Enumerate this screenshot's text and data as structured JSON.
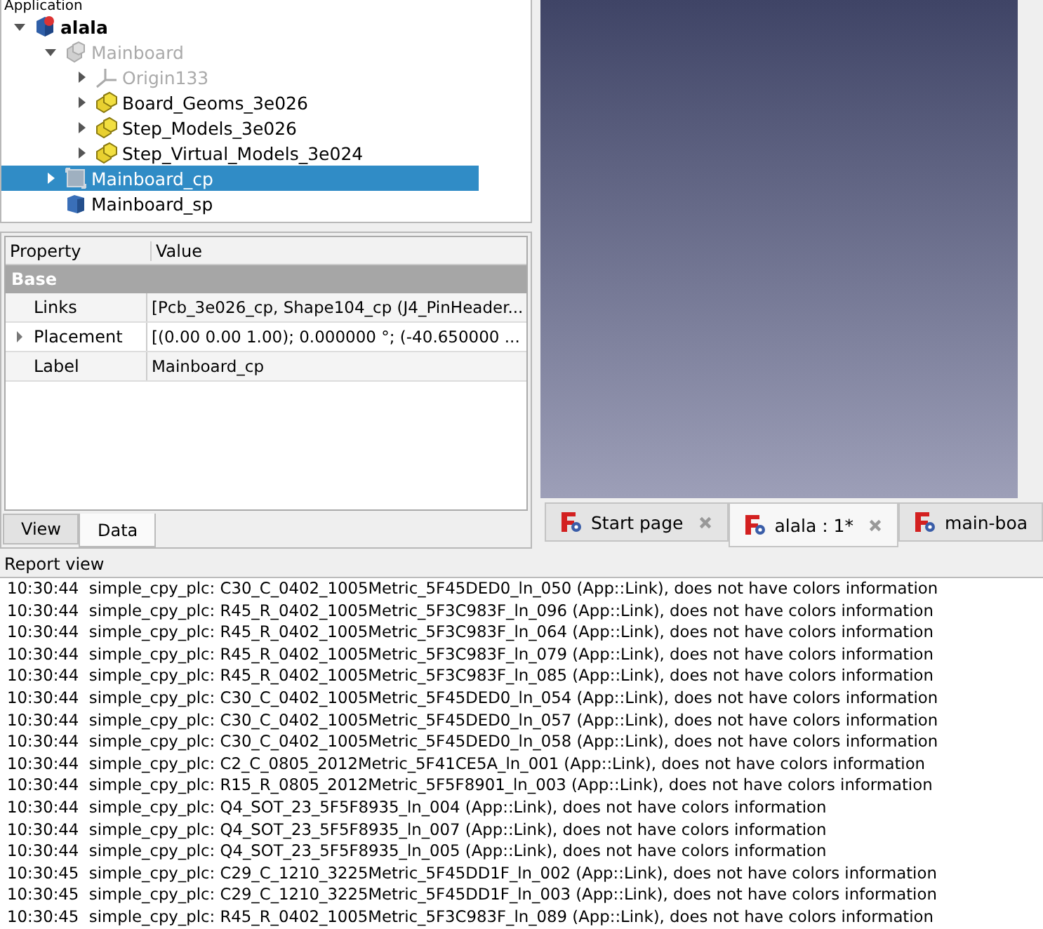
{
  "tree": {
    "title": "Application",
    "items": [
      {
        "label": "alala",
        "kind": "document",
        "bold": true,
        "dimmed": false,
        "selected": false,
        "expandable": true,
        "expanded": true,
        "children": [
          {
            "label": "Mainboard",
            "kind": "part",
            "bold": false,
            "dimmed": true,
            "selected": false,
            "expandable": true,
            "expanded": true,
            "children": [
              {
                "label": "Origin133",
                "kind": "origin",
                "bold": false,
                "dimmed": true,
                "selected": false,
                "expandable": true,
                "expanded": false
              },
              {
                "label": "Board_Geoms_3e026",
                "kind": "group",
                "bold": false,
                "dimmed": false,
                "selected": false,
                "expandable": true,
                "expanded": false
              },
              {
                "label": "Step_Models_3e026",
                "kind": "group",
                "bold": false,
                "dimmed": false,
                "selected": false,
                "expandable": true,
                "expanded": false
              },
              {
                "label": "Step_Virtual_Models_3e024",
                "kind": "group",
                "bold": false,
                "dimmed": false,
                "selected": false,
                "expandable": true,
                "expanded": false
              }
            ]
          },
          {
            "label": "Mainboard_cp",
            "kind": "link",
            "bold": false,
            "dimmed": false,
            "selected": true,
            "expandable": true,
            "expanded": false
          },
          {
            "label": "Mainboard_sp",
            "kind": "box",
            "bold": false,
            "dimmed": false,
            "selected": false,
            "expandable": false
          }
        ]
      }
    ]
  },
  "properties": {
    "columns": [
      "Property",
      "Value"
    ],
    "group": "Base",
    "rows": [
      {
        "name": "Links",
        "value": "[Pcb_3e026_cp, Shape104_cp (J4_PinHeader...",
        "expandable": false
      },
      {
        "name": "Placement",
        "value": "[(0.00 0.00 1.00); 0.000000 °; (-40.650000 ...",
        "expandable": true
      },
      {
        "name": "Label",
        "value": "Mainboard_cp",
        "expandable": false
      }
    ],
    "tabs": [
      {
        "label": "View",
        "selected": false
      },
      {
        "label": "Data",
        "selected": true
      }
    ]
  },
  "document_tabs": [
    {
      "label": "Start page",
      "selected": false,
      "closable": true
    },
    {
      "label": "alala : 1*",
      "selected": true,
      "closable": true
    },
    {
      "label": "main-boa",
      "selected": false,
      "closable": false
    }
  ],
  "report_view": {
    "title": "Report view",
    "lines": [
      {
        "time": "10:30:44",
        "message": "simple_cpy_plc: C30_C_0402_1005Metric_5F45DED0_ln_050 (App::Link), does not have colors information"
      },
      {
        "time": "10:30:44",
        "message": "simple_cpy_plc: R45_R_0402_1005Metric_5F3C983F_ln_096 (App::Link), does not have colors information"
      },
      {
        "time": "10:30:44",
        "message": "simple_cpy_plc: R45_R_0402_1005Metric_5F3C983F_ln_064 (App::Link), does not have colors information"
      },
      {
        "time": "10:30:44",
        "message": "simple_cpy_plc: R45_R_0402_1005Metric_5F3C983F_ln_079 (App::Link), does not have colors information"
      },
      {
        "time": "10:30:44",
        "message": "simple_cpy_plc: R45_R_0402_1005Metric_5F3C983F_ln_085 (App::Link), does not have colors information"
      },
      {
        "time": "10:30:44",
        "message": "simple_cpy_plc: C30_C_0402_1005Metric_5F45DED0_ln_054 (App::Link), does not have colors information"
      },
      {
        "time": "10:30:44",
        "message": "simple_cpy_plc: C30_C_0402_1005Metric_5F45DED0_ln_057 (App::Link), does not have colors information"
      },
      {
        "time": "10:30:44",
        "message": "simple_cpy_plc: C30_C_0402_1005Metric_5F45DED0_ln_058 (App::Link), does not have colors information"
      },
      {
        "time": "10:30:44",
        "message": "simple_cpy_plc: C2_C_0805_2012Metric_5F41CE5A_ln_001 (App::Link), does not have colors information"
      },
      {
        "time": "10:30:44",
        "message": "simple_cpy_plc: R15_R_0805_2012Metric_5F5F8901_ln_003 (App::Link), does not have colors information"
      },
      {
        "time": "10:30:44",
        "message": "simple_cpy_plc: Q4_SOT_23_5F5F8935_ln_004 (App::Link), does not have colors information"
      },
      {
        "time": "10:30:44",
        "message": "simple_cpy_plc: Q4_SOT_23_5F5F8935_ln_007 (App::Link), does not have colors information"
      },
      {
        "time": "10:30:44",
        "message": "simple_cpy_plc: Q4_SOT_23_5F5F8935_ln_005 (App::Link), does not have colors information"
      },
      {
        "time": "10:30:45",
        "message": "simple_cpy_plc: C29_C_1210_3225Metric_5F45DD1F_ln_002 (App::Link), does not have colors information"
      },
      {
        "time": "10:30:45",
        "message": "simple_cpy_plc: C29_C_1210_3225Metric_5F45DD1F_ln_003 (App::Link), does not have colors information"
      },
      {
        "time": "10:30:45",
        "message": "simple_cpy_plc: R45_R_0402_1005Metric_5F3C983F_ln_089 (App::Link), does not have colors information"
      }
    ]
  }
}
